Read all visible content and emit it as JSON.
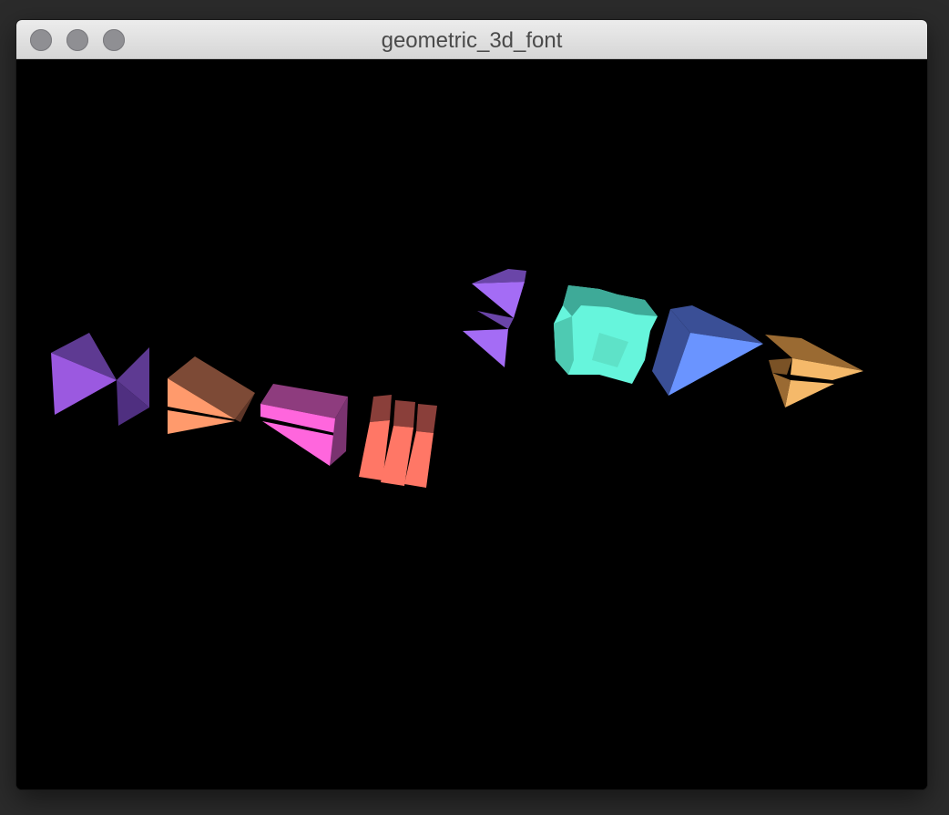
{
  "window": {
    "title": "geometric_3d_font",
    "buttons": [
      "close",
      "minimize",
      "zoom"
    ]
  },
  "scene": {
    "background": "#000000",
    "glyphs": [
      {
        "name": "glyph-1",
        "colors": [
          "#9b59e0",
          "#5e3a92"
        ]
      },
      {
        "name": "glyph-2",
        "colors": [
          "#ff9a6c",
          "#7d4a36"
        ]
      },
      {
        "name": "glyph-3",
        "colors": [
          "#ff66dd",
          "#8e3c7e"
        ]
      },
      {
        "name": "glyph-4",
        "colors": [
          "#ff7766",
          "#8a3f3a"
        ]
      },
      {
        "name": "glyph-5",
        "colors": [
          "#a46cf5",
          "#6a45a8"
        ]
      },
      {
        "name": "glyph-6",
        "colors": [
          "#66f5dc",
          "#3eaa98"
        ]
      },
      {
        "name": "glyph-7",
        "colors": [
          "#6a94ff",
          "#3a4f96"
        ]
      },
      {
        "name": "glyph-8",
        "colors": [
          "#f5b96a",
          "#9a6a32"
        ]
      }
    ]
  }
}
